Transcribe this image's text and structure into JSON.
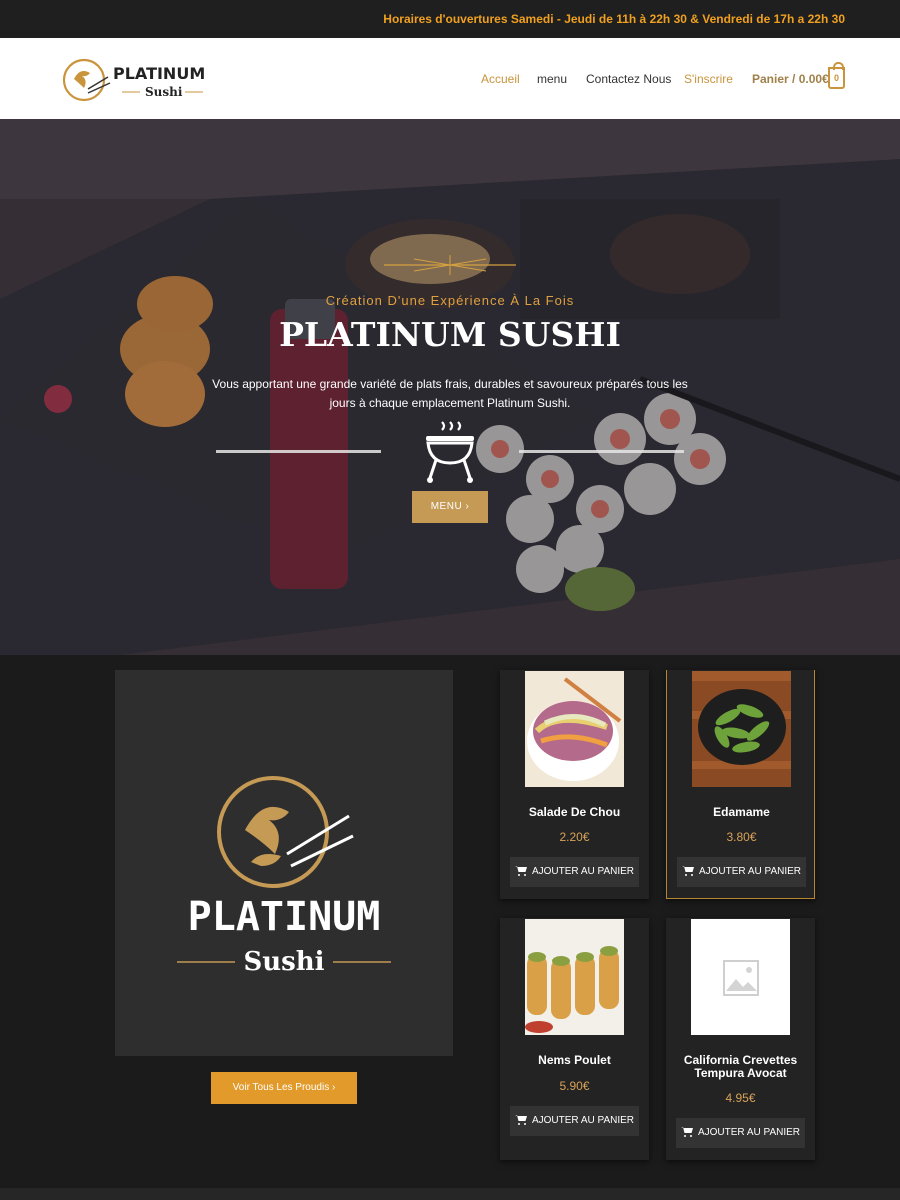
{
  "topbar": {
    "hours": "Horaires d'ouvertures Samedi - Jeudi de 11h à 22h 30 & Vendredi de 17h a 22h 30"
  },
  "brand": {
    "name": "PLATINUM",
    "sub": "Sushi",
    "gold": "#c9943c"
  },
  "nav": {
    "items": [
      "Accueil",
      "menu",
      "Contactez Nous",
      "S'inscrire"
    ],
    "cart_label": "Panier / 0.00€",
    "cart_count": "0"
  },
  "hero": {
    "subtitle": "Création D'une Expérience À La Fois",
    "title": "PLATINUM SUSHI",
    "description": "Vous apportant une grande variété de plats frais, durables et savoureux préparés tous les jours à chaque emplacement Platinum Sushi.",
    "icon": "grill-icon",
    "button": "MENU"
  },
  "products": {
    "all_button": "Voir Tous Les Proudis",
    "add_label": "AJOUTER AU PANIER",
    "items": [
      {
        "name": "Salade De Chou",
        "price": "2.20€"
      },
      {
        "name": "Edamame",
        "price": "3.80€"
      },
      {
        "name": "Nems Poulet",
        "price": "5.90€"
      },
      {
        "name": "California Crevettes Tempura Avocat",
        "price": "4.95€"
      }
    ]
  }
}
